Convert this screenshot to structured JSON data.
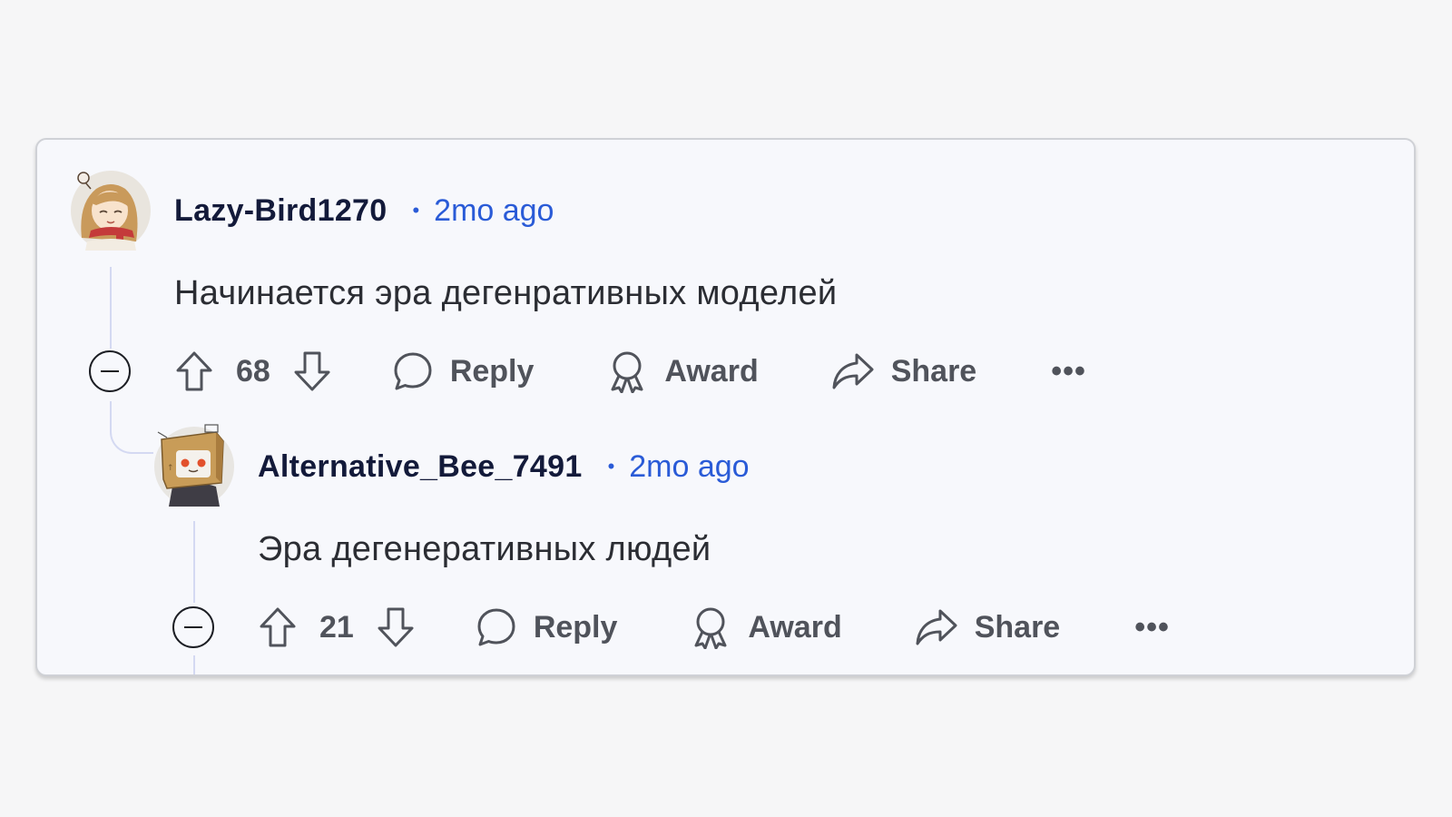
{
  "comments": [
    {
      "username": "Lazy-Bird1270",
      "separator": "•",
      "time": "2mo ago",
      "text": "Начинается эра дегенративных моделей",
      "score": "68",
      "reply_label": "Reply",
      "award_label": "Award",
      "share_label": "Share",
      "more_label": "•••"
    },
    {
      "username": "Alternative_Bee_7491",
      "separator": "•",
      "time": "2mo ago",
      "text": "Эра дегенеративных людей",
      "score": "21",
      "reply_label": "Reply",
      "award_label": "Award",
      "share_label": "Share",
      "more_label": "•••"
    }
  ],
  "colors": {
    "username": "#131a3a",
    "timestamp": "#2a5bd7",
    "action_text": "#50535b",
    "thread_line": "#d4d9f2",
    "card_bg": "#f7f8fc"
  },
  "icons": {
    "collapse": "collapse-minus-icon",
    "upvote": "arrow-up-icon",
    "downvote": "arrow-down-icon",
    "reply": "speech-bubble-icon",
    "award": "ribbon-award-icon",
    "share": "share-arrow-icon",
    "more": "ellipsis-icon"
  }
}
